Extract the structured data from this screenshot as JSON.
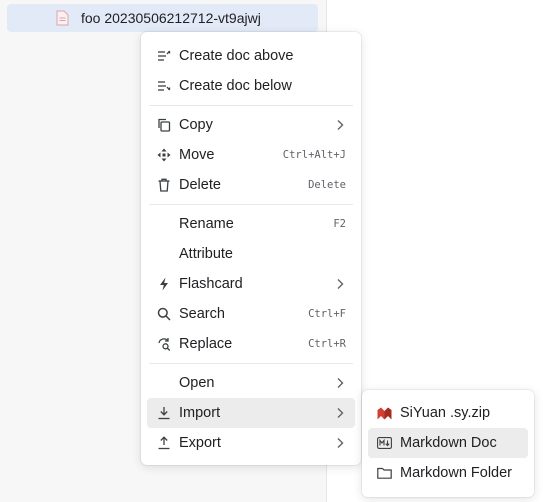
{
  "tree": {
    "doc_label": "foo 20230506212712-vt9ajwj"
  },
  "context_menu": {
    "create_above": "Create doc above",
    "create_below": "Create doc below",
    "copy": "Copy",
    "move": {
      "label": "Move",
      "shortcut": "Ctrl+Alt+J"
    },
    "delete": {
      "label": "Delete",
      "shortcut": "Delete"
    },
    "rename": {
      "label": "Rename",
      "shortcut": "F2"
    },
    "attribute": "Attribute",
    "flashcard": "Flashcard",
    "search": {
      "label": "Search",
      "shortcut": "Ctrl+F"
    },
    "replace": {
      "label": "Replace",
      "shortcut": "Ctrl+R"
    },
    "open": "Open",
    "import": "Import",
    "export": "Export"
  },
  "import_submenu": {
    "siyuan": "SiYuan .sy.zip",
    "markdown_doc": "Markdown Doc",
    "markdown_folder": "Markdown Folder"
  },
  "colors": {
    "selected_row": "#e3eaf7",
    "hover": "#ececec",
    "siyuan_brand": "#d23f31"
  }
}
